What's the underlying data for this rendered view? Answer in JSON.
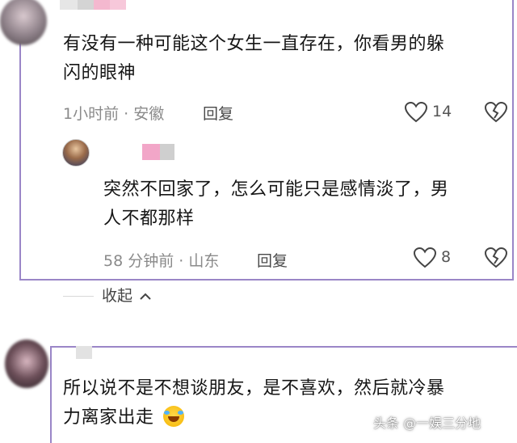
{
  "comments": [
    {
      "text_line1": "有没有一种可能这个女生一直存在，你看男的躲",
      "text_line2": "闪的眼神",
      "meta": "1小时前 · 安徽",
      "reply_label": "回复",
      "likes": "14"
    },
    {
      "text_line1": "突然不回家了，怎么可能只是感情淡了，男",
      "text_line2": "人不都那样",
      "meta": "58 分钟前 · 山东",
      "reply_label": "回复",
      "likes": "8"
    },
    {
      "text_line1": "所以说不是不想谈朋友，是不喜欢，然后就冷暴",
      "text_line2": "力离家出走"
    }
  ],
  "collapse_label": "收起",
  "watermark": "头条 @一娱三分地",
  "colors": {
    "frame": "#9a86c7",
    "mosaic_pink": "#f2a6c8",
    "mosaic_gray": "#cfcfcf"
  }
}
